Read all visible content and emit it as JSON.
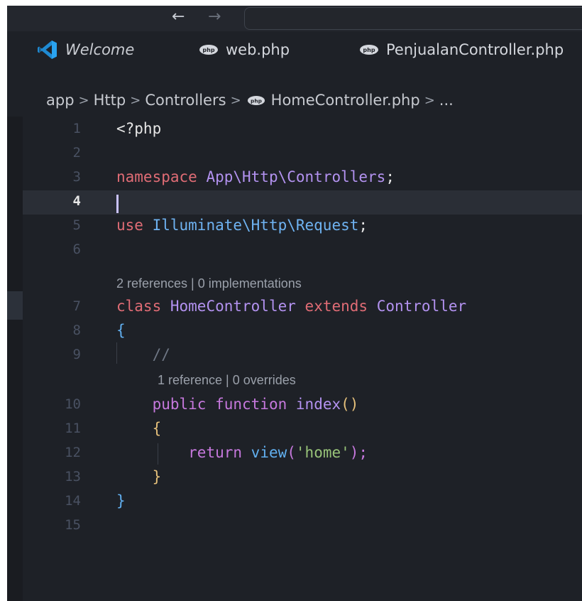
{
  "nav": {
    "back_glyph": "←",
    "forward_glyph": "→"
  },
  "tabs": [
    {
      "label": "Welcome",
      "icon": "vscode-logo-icon"
    },
    {
      "label": "web.php",
      "icon": "php-file-icon"
    },
    {
      "label": "PenjualanController.php",
      "icon": "php-file-icon"
    }
  ],
  "breadcrumb": {
    "items": [
      "app",
      "Http",
      "Controllers",
      "HomeController.php",
      "..."
    ],
    "separator": ">"
  },
  "editor": {
    "active_line": "4",
    "lines": [
      {
        "num": "1",
        "tokens": [
          "<?php"
        ]
      },
      {
        "num": "2",
        "tokens": []
      },
      {
        "num": "3",
        "tokens": [
          "namespace",
          " ",
          "App\\Http\\Controllers",
          ";"
        ]
      },
      {
        "num": "4",
        "tokens": []
      },
      {
        "num": "5",
        "tokens": [
          "use",
          " ",
          "Illuminate\\Http\\Request",
          ";"
        ]
      },
      {
        "num": "6",
        "tokens": []
      },
      {
        "num": "7",
        "tokens": [
          "class",
          " ",
          "HomeController",
          " ",
          "extends",
          " ",
          "Controller"
        ]
      },
      {
        "num": "8",
        "tokens": [
          "{"
        ]
      },
      {
        "num": "9",
        "tokens": [
          "    ",
          "//"
        ]
      },
      {
        "num": "10",
        "tokens": [
          "    ",
          "public",
          " ",
          "function",
          " ",
          "index",
          "()"
        ]
      },
      {
        "num": "11",
        "tokens": [
          "    ",
          "{"
        ]
      },
      {
        "num": "12",
        "tokens": [
          "        ",
          "return",
          " ",
          "view",
          "(",
          "'home'",
          ");"
        ]
      },
      {
        "num": "13",
        "tokens": [
          "    ",
          "}"
        ]
      },
      {
        "num": "14",
        "tokens": [
          "}"
        ]
      },
      {
        "num": "15",
        "tokens": []
      }
    ],
    "codelens": {
      "class": "2 references | 0 implementations",
      "method": "1 reference | 0 overrides"
    }
  },
  "colors": {
    "background": "#1e2127",
    "keyword_red": "#e06c75",
    "keyword_purple": "#c678dd",
    "class_blue": "#61afef",
    "class_gold": "#e5c07b",
    "string_green": "#98c379",
    "comment_gray": "#6f7785"
  }
}
